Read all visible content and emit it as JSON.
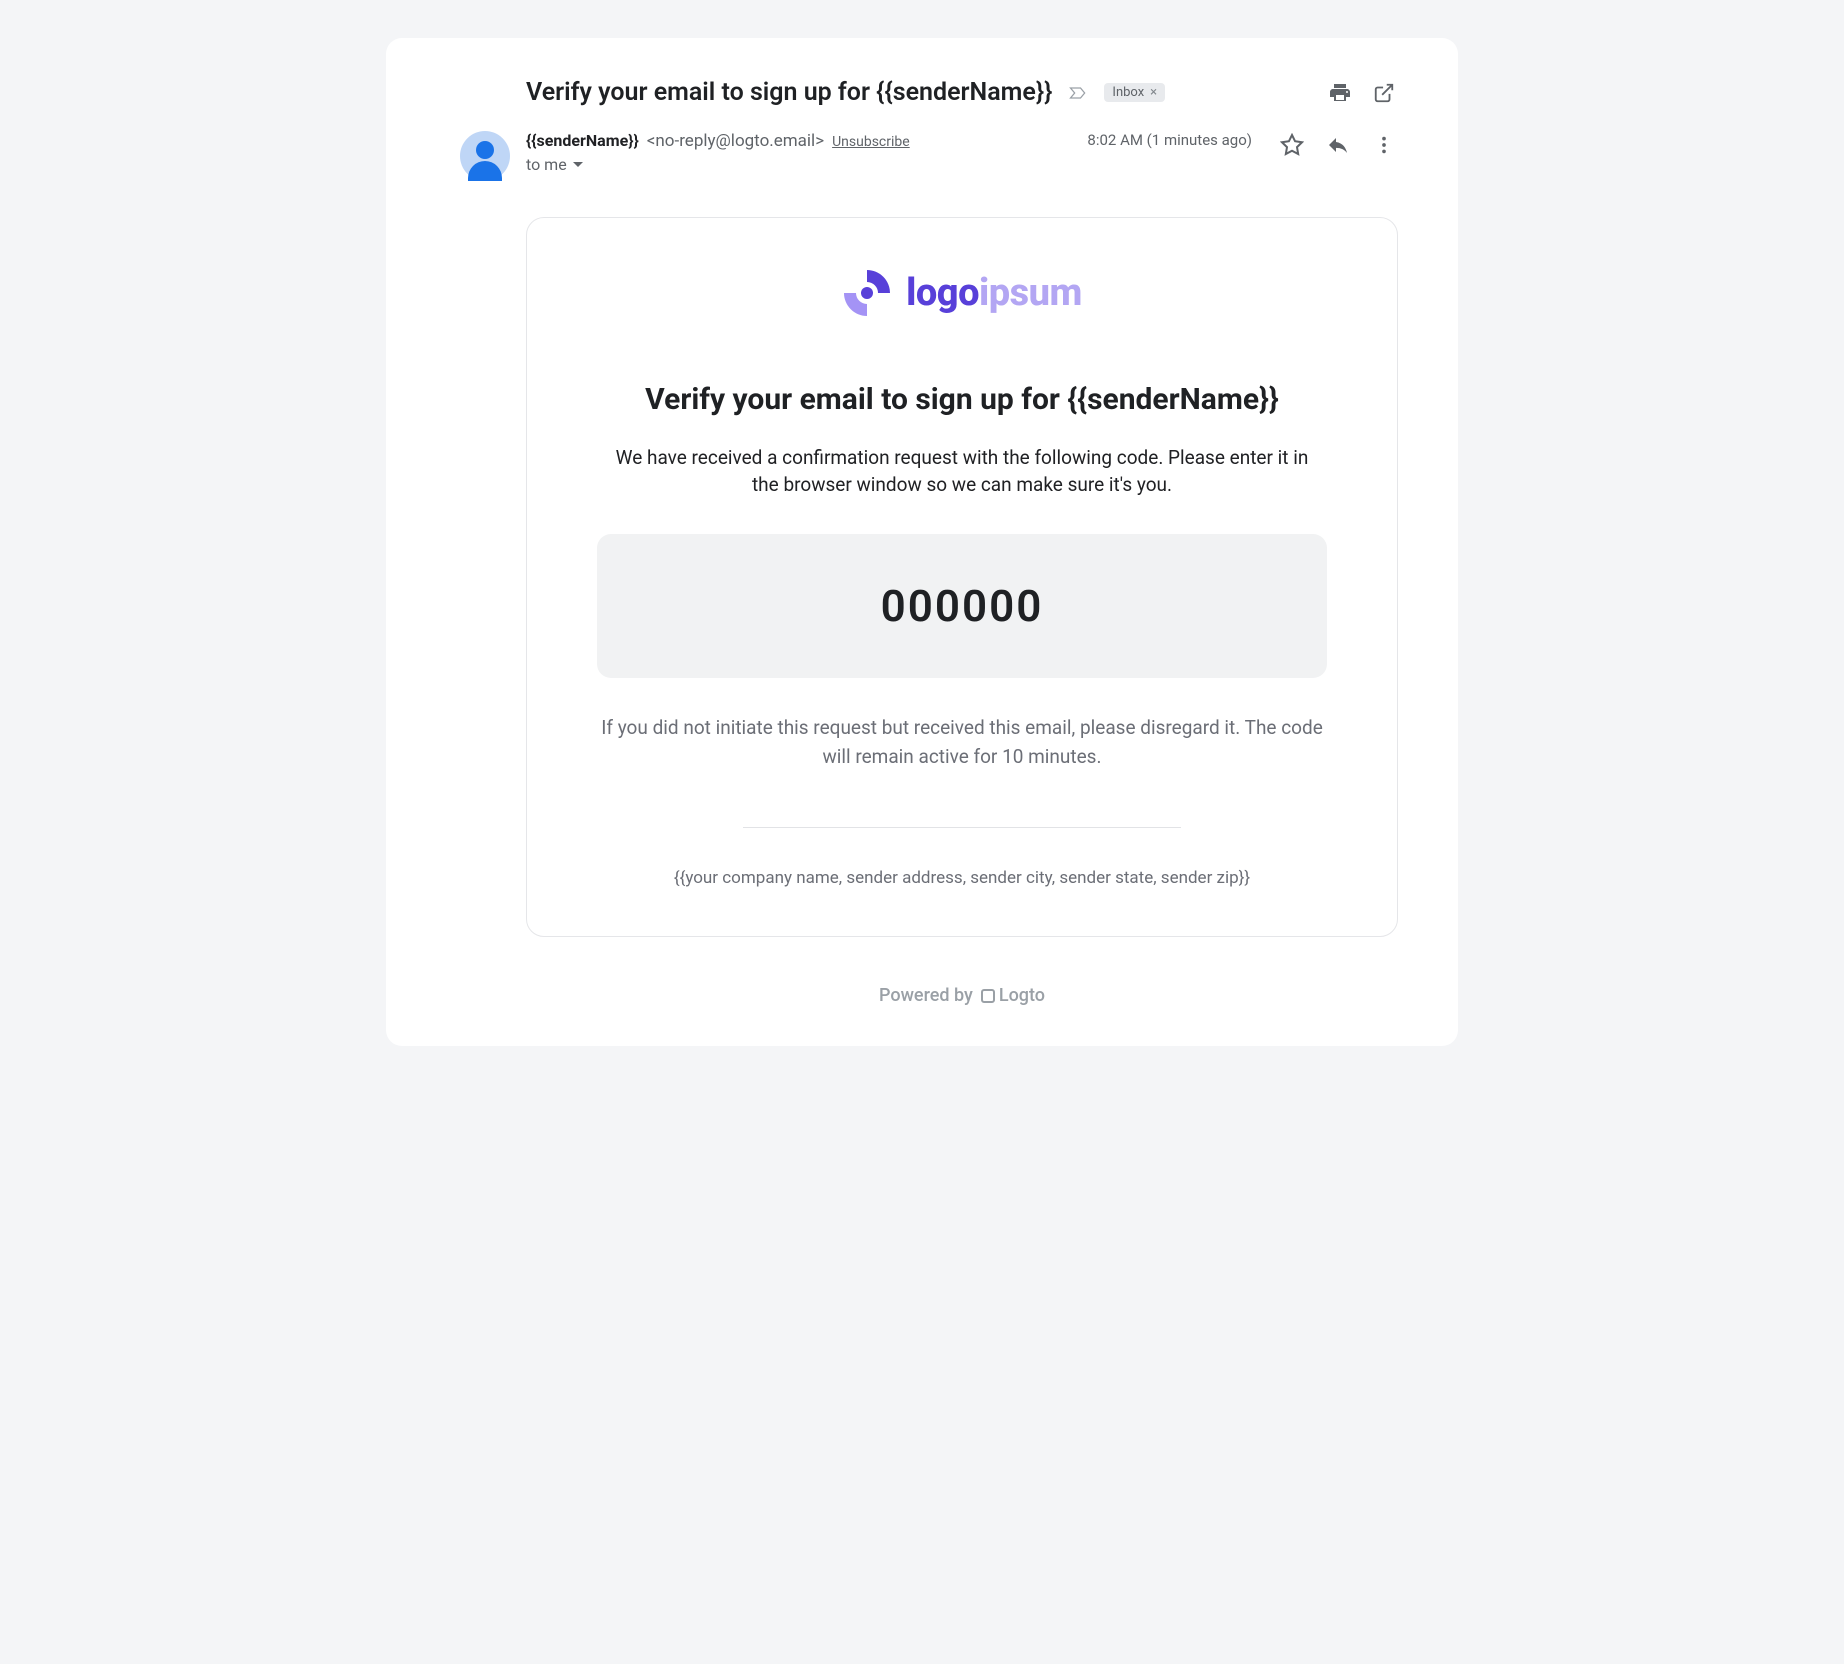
{
  "header": {
    "subject": "Verify your email to sign up for {{senderName}}",
    "inbox_label": "Inbox"
  },
  "meta": {
    "sender_name": "{{senderName}}",
    "sender_email": "<no-reply@logto.email>",
    "unsubscribe": "Unsubscribe",
    "to_line": "to me",
    "timestamp": "8:02 AM (1 minutes ago)"
  },
  "body": {
    "logo_part1": "logo",
    "logo_part2": "ipsum",
    "title": "Verify your email to sign up for {{senderName}}",
    "paragraph": "We have received a confirmation request with the following code. Please enter it in the browser window so we can make sure it's you.",
    "code": "000000",
    "disclaimer": "If you did not initiate this request but received this email, please disregard it. The code will remain active for 10 minutes.",
    "company_footer": "{{your company name, sender address, sender city, sender state, sender zip}}"
  },
  "powered": {
    "prefix": "Powered by",
    "brand": "Logto"
  }
}
